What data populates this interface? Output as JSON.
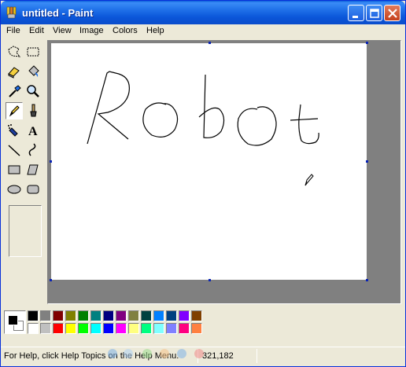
{
  "window": {
    "title": "untitled - Paint"
  },
  "menu": [
    "File",
    "Edit",
    "View",
    "Image",
    "Colors",
    "Help"
  ],
  "canvas": {
    "text": "Robot"
  },
  "palette": {
    "foreground": "#000000",
    "background": "#ffffff",
    "colors_top": [
      "#000000",
      "#808080",
      "#800000",
      "#808000",
      "#008000",
      "#008080",
      "#000080",
      "#800080",
      "#808040",
      "#004040",
      "#0080ff",
      "#004080",
      "#8000ff",
      "#804000"
    ],
    "colors_bottom": [
      "#ffffff",
      "#c0c0c0",
      "#ff0000",
      "#ffff00",
      "#00ff00",
      "#00ffff",
      "#0000ff",
      "#ff00ff",
      "#ffff80",
      "#00ff80",
      "#80ffff",
      "#8080ff",
      "#ff0080",
      "#ff8040"
    ]
  },
  "status": {
    "help_text": "For Help, click Help Topics on the Help Menu.",
    "coords": "321,182"
  },
  "watermark_text": "Download.com.vn"
}
